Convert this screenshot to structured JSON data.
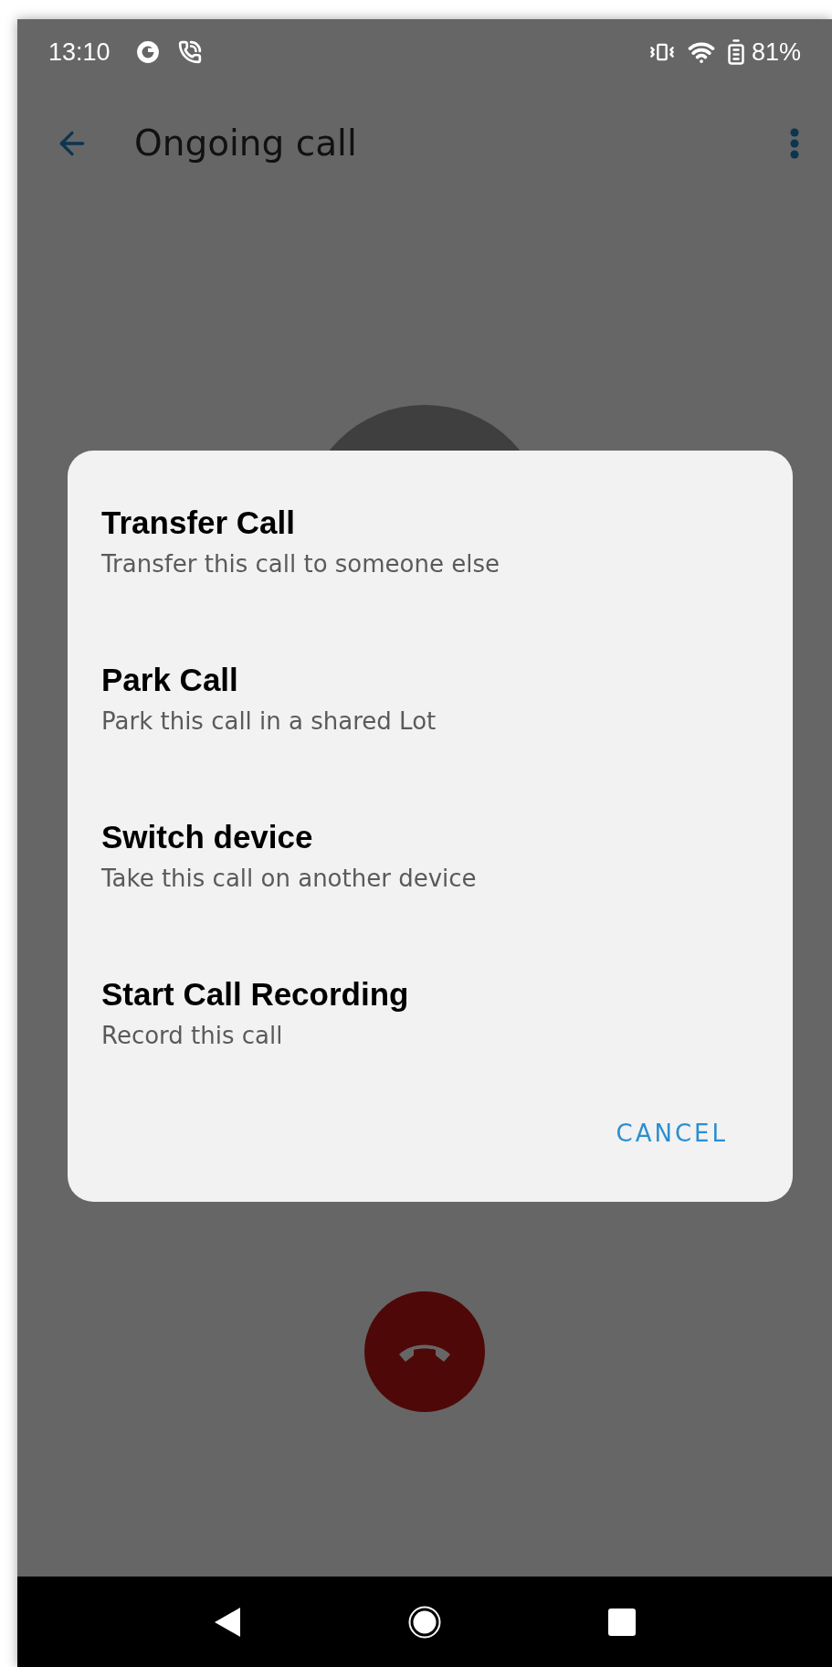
{
  "status_bar": {
    "time": "13:10",
    "battery": "81%"
  },
  "app_bar": {
    "title": "Ongoing call"
  },
  "dialog": {
    "items": [
      {
        "title": "Transfer Call",
        "subtitle": "Transfer this call to someone else"
      },
      {
        "title": "Park Call",
        "subtitle": "Park this call in a shared Lot"
      },
      {
        "title": "Switch device",
        "subtitle": "Take this call on another device"
      },
      {
        "title": "Start Call Recording",
        "subtitle": "Record this call"
      }
    ],
    "cancel": "CANCEL"
  }
}
